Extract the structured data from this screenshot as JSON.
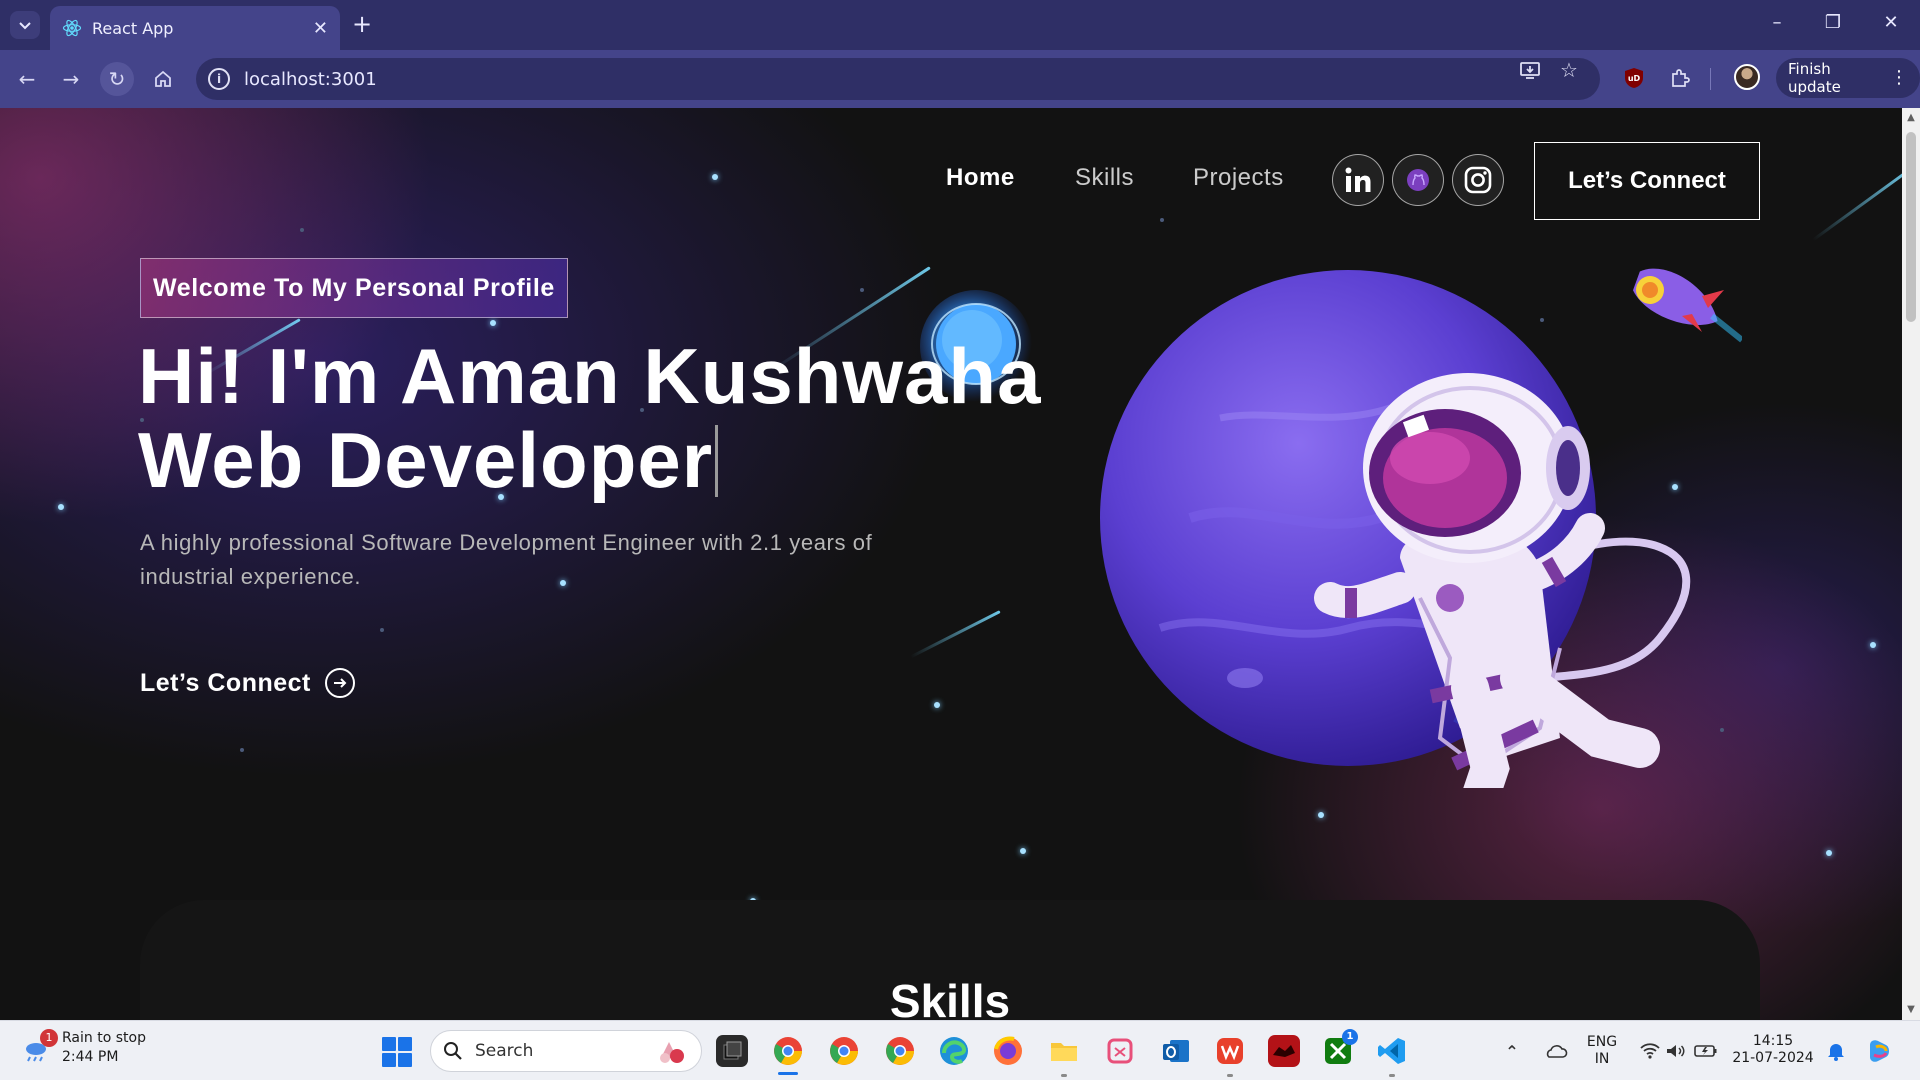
{
  "browser": {
    "tab_title": "React App",
    "url": "localhost:3001",
    "finish_update_label": "Finish update",
    "icons": {
      "tab_search": "chevron-down-icon",
      "new_tab": "plus-icon",
      "back": "back-arrow-icon",
      "forward": "forward-arrow-icon",
      "reload": "reload-icon",
      "home": "home-icon",
      "site_info": "info-icon",
      "install": "install-app-icon",
      "bookmark": "star-icon",
      "extensions": "puzzle-icon",
      "menu": "kebab-menu-icon"
    }
  },
  "page": {
    "nav": {
      "links": [
        "Home",
        "Skills",
        "Projects"
      ],
      "active": "Home",
      "social": [
        "linkedin-icon",
        "github-icon",
        "instagram-icon"
      ],
      "connect_button": "Let’s Connect"
    },
    "hero": {
      "tagline": "Welcome To My Personal Profile",
      "title_line1": "Hi! I'm Aman Kushwaha",
      "title_line2": "Web Developer",
      "description": "A highly professional Software Development Engineer with 2.1 years of industrial experience.",
      "connect_link": "Let’s Connect"
    },
    "skills": {
      "title": "Skills"
    },
    "colors": {
      "background": "#121212",
      "gradient_pink": "#AA367C",
      "gradient_purple": "#4A2FBD",
      "star": "#A8E1FF"
    }
  },
  "taskbar": {
    "weather_alert_count": "1",
    "weather_title": "Rain to stop",
    "weather_time": "2:44 PM",
    "search_placeholder": "Search",
    "lang_line1": "ENG",
    "lang_line2": "IN",
    "clock_time": "14:15",
    "clock_date": "21-07-2024",
    "xbox_badge": "1",
    "apps": [
      "task-view",
      "chrome-profile-1",
      "chrome-profile-2",
      "chrome-profile-3",
      "edge",
      "firefox",
      "file-explorer",
      "snipping-tool",
      "outlook",
      "wps-office",
      "app-red",
      "xbox",
      "vscode"
    ]
  }
}
